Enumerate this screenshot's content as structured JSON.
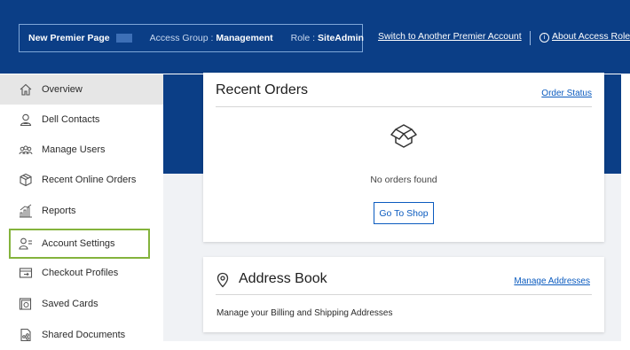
{
  "header": {
    "premier_page": "New Premier Page",
    "access_group_label": "Access Group :",
    "access_group_value": "Management",
    "role_label": "Role :",
    "role_value": "SiteAdmin",
    "switch_link": "Switch to Another Premier Account",
    "about_link": "About Access Roles",
    "info_glyph": "i"
  },
  "sidebar": {
    "items": [
      {
        "label": "Overview",
        "icon": "home-icon"
      },
      {
        "label": "Dell Contacts",
        "icon": "contact-icon"
      },
      {
        "label": "Manage Users",
        "icon": "users-icon"
      },
      {
        "label": "Recent Online Orders",
        "icon": "package-icon"
      },
      {
        "label": "Reports",
        "icon": "reports-icon"
      },
      {
        "label": "Account Settings",
        "icon": "account-settings-icon"
      },
      {
        "label": "Checkout Profiles",
        "icon": "checkout-icon"
      },
      {
        "label": "Saved Cards",
        "icon": "card-icon"
      },
      {
        "label": "Shared Documents",
        "icon": "documents-icon"
      }
    ],
    "active_index": 0,
    "highlight_index": 5
  },
  "recent_orders": {
    "title": "Recent Orders",
    "link": "Order Status",
    "empty_text": "No orders found",
    "button": "Go To Shop"
  },
  "address_book": {
    "title": "Address Book",
    "link": "Manage Addresses",
    "description": "Manage your Billing and Shipping Addresses"
  },
  "colors": {
    "brand_blue": "#0b3e86",
    "link_blue": "#0b5bbf",
    "highlight_green": "#84b33c"
  }
}
